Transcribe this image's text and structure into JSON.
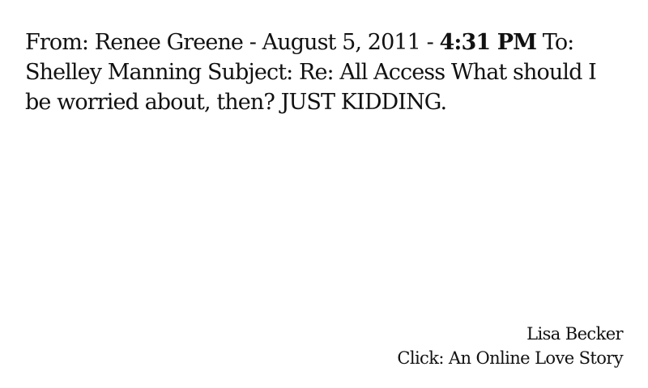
{
  "quote": {
    "before_time": "From: Renee Greene - August 5, 2011 - ",
    "time": "4:31 PM",
    "after_time": " To: Shelley Manning Subject: Re: All Access What should I be worried about, then? JUST KIDDING."
  },
  "attribution": {
    "author": "Lisa Becker",
    "title": "Click: An Online Love Story"
  }
}
